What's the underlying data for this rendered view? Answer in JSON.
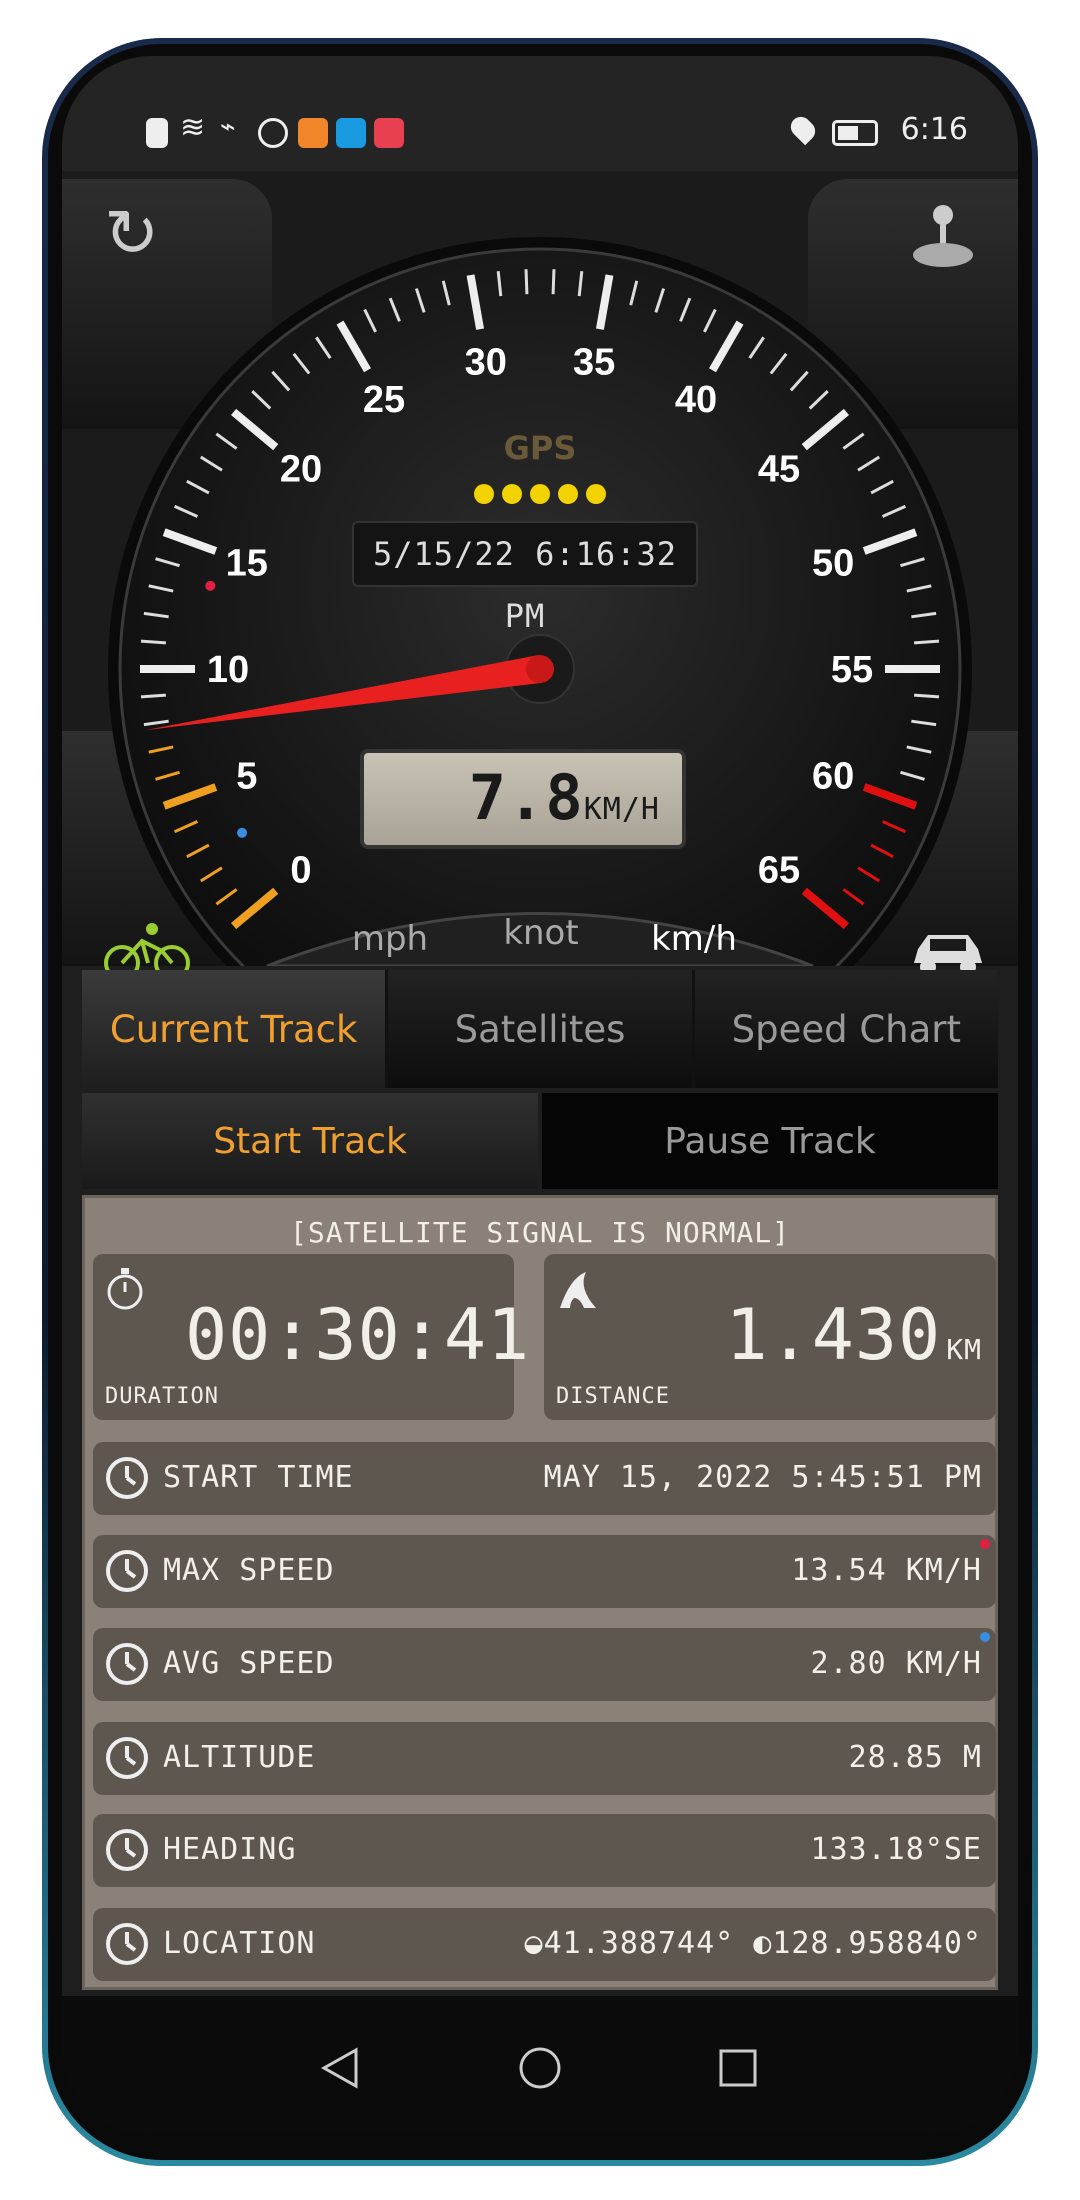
{
  "status_bar": {
    "time": "6:16",
    "icons": [
      "alert-icon",
      "wifi-icon",
      "satellite-icon",
      "globe-icon",
      "video-app-icon",
      "search-app-icon",
      "huawei-app-icon"
    ],
    "right_icons": [
      "location-icon",
      "battery-icon"
    ]
  },
  "gauge": {
    "min": 0,
    "max": 65,
    "major_step": 5,
    "labels": [
      "0",
      "5",
      "10",
      "15",
      "20",
      "25",
      "30",
      "35",
      "40",
      "45",
      "50",
      "55",
      "60",
      "65"
    ],
    "speed": 7.8,
    "max_speed_marker": 13.54,
    "avg_speed_marker": 2.8,
    "low_zone_max": 7,
    "high_zone_min": 60,
    "low_color": "#f0a020",
    "high_color": "#e01010",
    "needle_color": "#e82020",
    "gps_label": "GPS",
    "gps_dots": 5,
    "gps_dot_color": "#f2d200",
    "datetime": "5/15/22 6:16:32 PM",
    "speed_value": "7.8",
    "speed_unit": "KM/H"
  },
  "units": {
    "items": [
      "mph",
      "knot",
      "km/h"
    ],
    "selected": "km/h"
  },
  "corners": {
    "reset": "refresh-icon",
    "mode": "joystick-icon",
    "bike": "bicycle-icon",
    "car": "car-icon",
    "bike_color": "#9acd32"
  },
  "tabs": [
    {
      "label": "Current Track",
      "active": true
    },
    {
      "label": "Satellites",
      "active": false
    },
    {
      "label": "Speed Chart",
      "active": false
    }
  ],
  "track_buttons": {
    "start": "Start Track",
    "pause": "Pause Track"
  },
  "info": {
    "signal": "[SATELLITE SIGNAL IS NORMAL]",
    "duration": {
      "label": "DURATION",
      "value": "00:30:41"
    },
    "distance": {
      "label": "DISTANCE",
      "value": "1.430",
      "unit": "KM"
    },
    "rows": [
      {
        "label": "START TIME",
        "value": "MAY 15, 2022 5:45:51 PM",
        "icon": "clock-icon"
      },
      {
        "label": "MAX SPEED",
        "value": "13.54 KM/H",
        "icon": "speedometer-max-icon",
        "dot": "#e02040"
      },
      {
        "label": "AVG SPEED",
        "value": "2.80 KM/H",
        "icon": "speedometer-avg-icon",
        "dot": "#3a8ee0"
      },
      {
        "label": "ALTITUDE",
        "value": "28.85 M",
        "icon": "mountain-icon"
      },
      {
        "label": "HEADING",
        "value": "133.18°SE",
        "icon": "compass-icon"
      },
      {
        "label": "LOCATION",
        "value": "◒41.388744° ◐128.958840°",
        "icon": "crosshair-icon"
      }
    ]
  },
  "nav": [
    "back-icon",
    "home-icon",
    "recents-icon"
  ]
}
